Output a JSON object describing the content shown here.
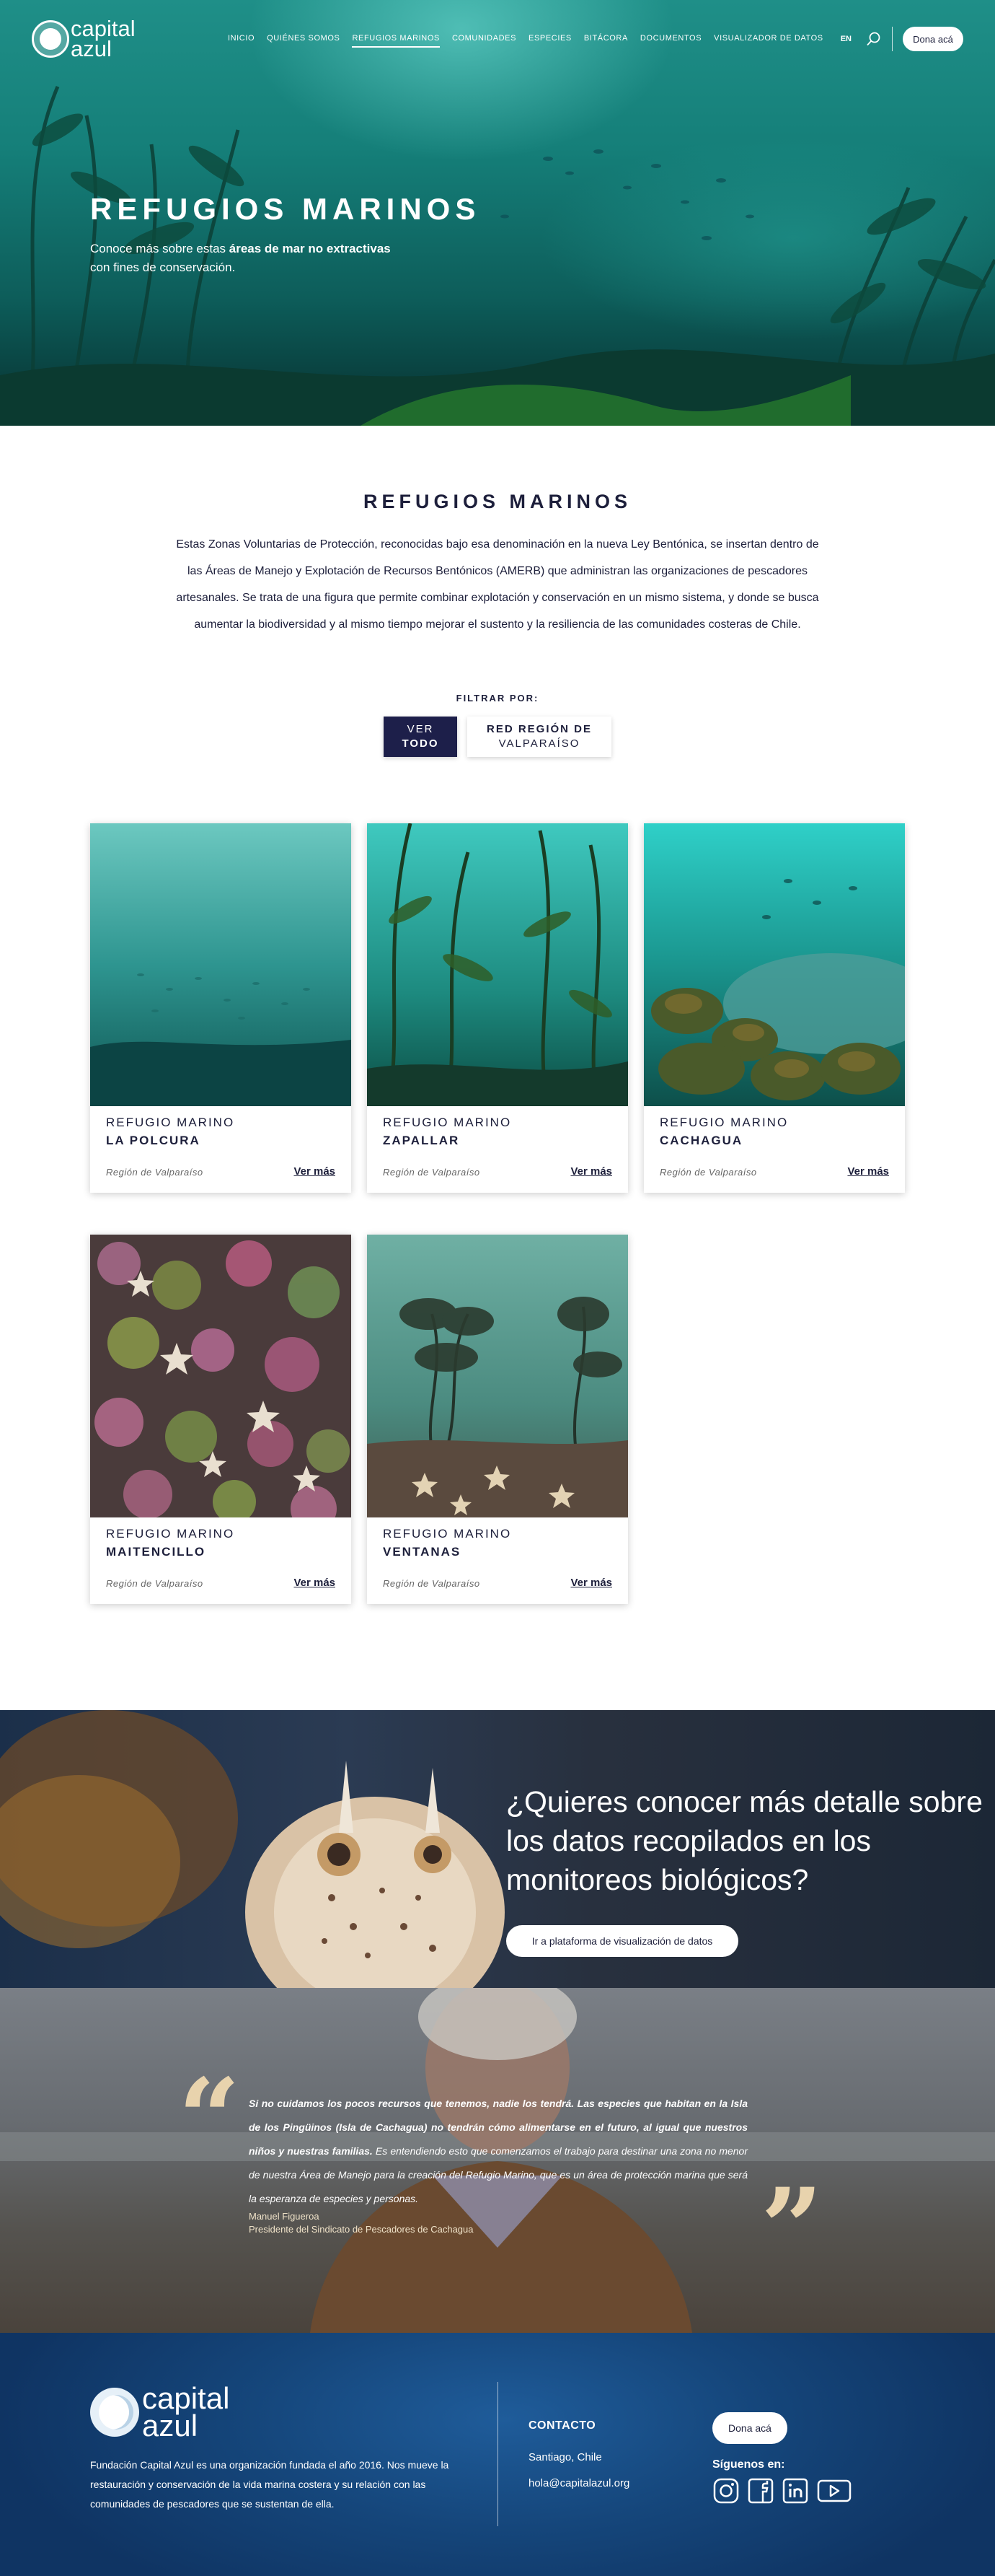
{
  "brand": {
    "line1": "capital",
    "line2": "azul"
  },
  "nav": {
    "items": [
      "INICIO",
      "QUIÉNES SOMOS",
      "REFUGIOS MARINOS",
      "COMUNIDADES",
      "ESPECIES",
      "BITÁCORA",
      "DOCUMENTOS",
      "VISUALIZADOR DE DATOS"
    ],
    "active": "REFUGIOS MARINOS",
    "lang": "EN",
    "donate": "Dona acá"
  },
  "hero": {
    "title": "REFUGIOS MARINOS",
    "subtitle_pre": "Conoce más sobre estas ",
    "subtitle_bold": "áreas de mar no extractivas",
    "subtitle_post": "con fines de conservación."
  },
  "intro": {
    "title": "REFUGIOS MARINOS",
    "text": "Estas Zonas Voluntarias de Protección, reconocidas bajo esa denominación en la nueva Ley Bentónica, se insertan dentro de las Áreas de Manejo y Explotación de Recursos Bentónicos (AMERB) que administran las organizaciones de pescadores artesanales. Se trata de una figura que permite combinar explotación y conservación en un mismo sistema, y donde se busca aumentar la biodiversidad y al mismo tiempo mejorar el sustento y la resiliencia de las comunidades costeras de Chile.",
    "filter_label": "FILTRAR POR:",
    "filter_all_top": "VER",
    "filter_all_bottom": "TODO",
    "filter_region_top": "RED REGIÓN DE",
    "filter_region_bottom": "VALPARAÍSO"
  },
  "cards": [
    {
      "kicker": "REFUGIO MARINO",
      "name": "LA POLCURA",
      "region": "Región de Valparaíso",
      "more": "Ver más"
    },
    {
      "kicker": "REFUGIO MARINO",
      "name": "ZAPALLAR",
      "region": "Región de Valparaíso",
      "more": "Ver más"
    },
    {
      "kicker": "REFUGIO MARINO",
      "name": "CACHAGUA",
      "region": "Región de Valparaíso",
      "more": "Ver más"
    },
    {
      "kicker": "REFUGIO MARINO",
      "name": "MAITENCILLO",
      "region": "Región de Valparaíso",
      "more": "Ver más"
    },
    {
      "kicker": "REFUGIO MARINO",
      "name": "VENTANAS",
      "region": "Región de Valparaíso",
      "more": "Ver más"
    }
  ],
  "databanner": {
    "heading": "¿Quieres conocer más detalle sobre los datos recopilados en los monitoreos biológicos?",
    "button": "Ir a plataforma de visualización de datos"
  },
  "quote": {
    "bold_text": "Si no cuidamos los pocos recursos que tenemos, nadie los tendrá. Las especies que habitan en la Isla de los Pingüinos (Isla de Cachagua) no tendrán cómo alimentarse en el futuro, al igual que nuestros niños y nuestras familias.",
    "text": " Es entendiendo esto que comenzamos el trabajo para destinar una zona no menor de nuestra Área de Manejo para la creación del Refugio Marino, que es un área de protección marina que será la esperanza de especies y personas.",
    "author": "Manuel Figueroa",
    "role": "Presidente del Sindicato de Pescadores de Cachagua",
    "open_mark": "“",
    "close_mark": "”"
  },
  "footer": {
    "about": "Fundación Capital Azul es una organización fundada el año 2016. Nos mueve la restauración y conservación de la vida marina costera y su relación con las comunidades de pescadores que se sustentan de ella.",
    "contact_title": "CONTACTO",
    "city": "Santiago, Chile",
    "email": "hola@capitalazul.org",
    "donate": "Dona acá",
    "follow": "Síguenos en:"
  }
}
